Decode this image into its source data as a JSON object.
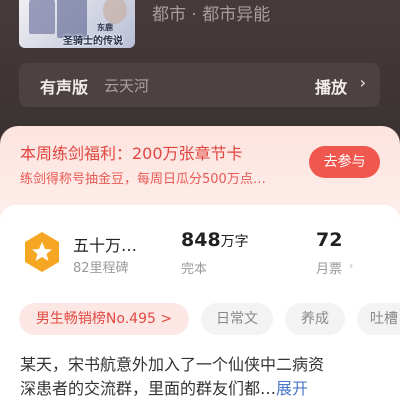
{
  "book": {
    "cover_author": "东鹿",
    "cover_title": "圣骑士的传说",
    "category": "都市 · 都市异能"
  },
  "audio": {
    "label": "有声版",
    "narrator": "云天河",
    "play_label": "播放",
    "chevron": "›"
  },
  "promo": {
    "title": "本周练剑福利：200万张章节卡",
    "desc": "练剑得称号抽金豆，每周日瓜分500万点…",
    "button": "去参与"
  },
  "stats": {
    "rank_name": "五十万…",
    "rank_sub": "82里程碑",
    "words_value": "848",
    "words_unit": "万字",
    "words_label": "完本",
    "monthly_value": "72",
    "monthly_label": "月票",
    "chevron": "›"
  },
  "tags": {
    "hot": "男生畅销榜No.495 >",
    "items": [
      "日常文",
      "养成",
      "吐槽"
    ]
  },
  "synopsis": {
    "line1": "某天，宋书航意外加入了一个仙侠中二病资",
    "line2": "深患者的交流群，里面的群友们都…",
    "more": "展开"
  },
  "colors": {
    "accent": "#f0574f",
    "promo_bg": "#fde3de",
    "top_bg": "#3e3534",
    "link": "#4a78c8",
    "badge": "#f5a623"
  },
  "icons": {
    "badge": "star-badge-icon",
    "chevron": "chevron-right-icon"
  }
}
